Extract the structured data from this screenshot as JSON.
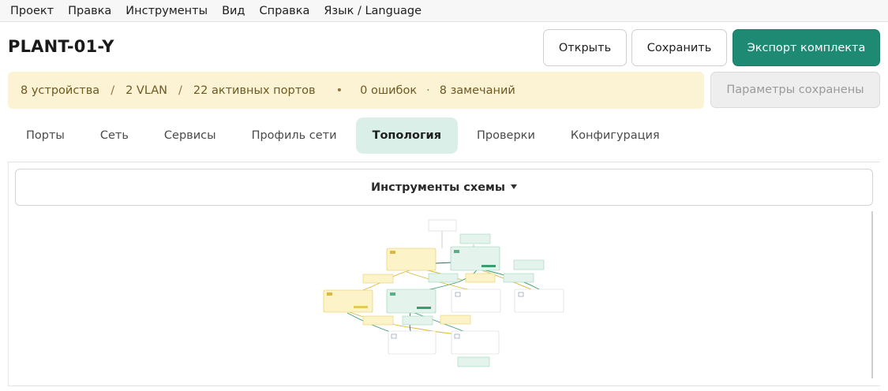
{
  "menu": {
    "items": [
      "Проект",
      "Правка",
      "Инструменты",
      "Вид",
      "Справка",
      "Язык / Language"
    ]
  },
  "header": {
    "title": "PLANT-01-Y",
    "open_label": "Открыть",
    "save_label": "Сохранить",
    "export_label": "Экспорт комплекта"
  },
  "status": {
    "devices": "8 устройства",
    "sep": "/",
    "vlan": "2 VLAN",
    "ports": "22 активных портов",
    "bullet": "•",
    "errors": "0 ошибок",
    "middot": "·",
    "warnings": "8 замечаний",
    "saved_label": "Параметры сохранены"
  },
  "tabs": [
    {
      "label": "Порты",
      "active": false
    },
    {
      "label": "Сеть",
      "active": false
    },
    {
      "label": "Сервисы",
      "active": false
    },
    {
      "label": "Профиль сети",
      "active": false
    },
    {
      "label": "Топология",
      "active": true
    },
    {
      "label": "Проверки",
      "active": false
    },
    {
      "label": "Конфигурация",
      "active": false
    }
  ],
  "diagram": {
    "tools_label": "Инструменты схемы",
    "colors": {
      "yellow_fill": "#fdf3c8",
      "yellow_stroke": "#e3c75c",
      "green_fill": "#e4f4ec",
      "green_stroke": "#8fcfb0",
      "white_fill": "#ffffff",
      "white_stroke": "#d6d6d6",
      "link_yellow": "#d9b936",
      "link_green": "#3a9d6e",
      "link_dark": "#2f6e57"
    }
  }
}
